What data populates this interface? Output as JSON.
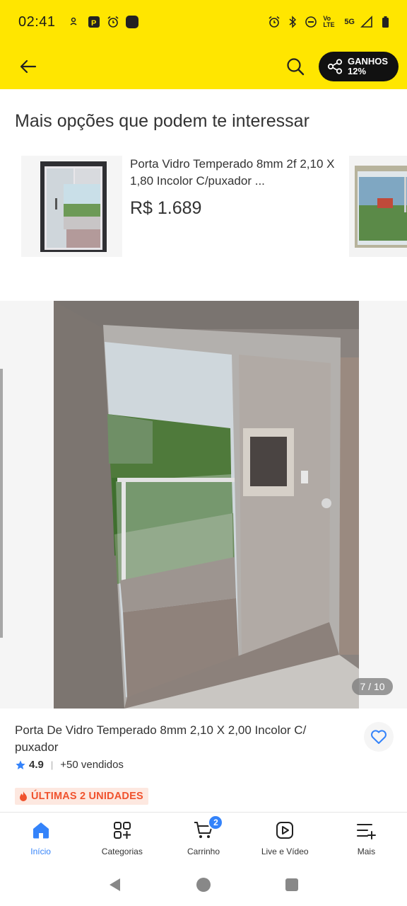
{
  "status_bar": {
    "time": "02:41",
    "network_label": "Vo LTE",
    "network_type": "5G",
    "icons": [
      "user-settings-icon",
      "parking-icon",
      "alarm-icon",
      "app-icon",
      "alarm-icon",
      "bluetooth-icon",
      "do-not-disturb-icon",
      "volte-icon",
      "signal-icon",
      "battery-icon"
    ]
  },
  "header": {
    "back_icon": "arrow-left-icon",
    "search_icon": "search-icon",
    "earn_button": {
      "line1": "GANHOS",
      "line2": "12%",
      "icon": "share-icon"
    }
  },
  "recommendations": {
    "title": "Mais opções que podem te interessar",
    "items": [
      {
        "title": "Porta Vidro Temperado 8mm 2f 2,10 X 1,80 Incolor C/puxador ...",
        "price": "R$ 1.689"
      }
    ]
  },
  "gallery": {
    "counter": "7 / 10"
  },
  "product": {
    "title": "Porta De Vidro Temperado 8mm 2,10 X 2,00 Incolor C/ puxador",
    "rating": "4.9",
    "sold": "+50 vendidos",
    "badge": "ÚLTIMAS 2 UNIDADES"
  },
  "bottom_nav": {
    "items": [
      {
        "label": "Início",
        "icon": "home-icon",
        "active": true
      },
      {
        "label": "Categorias",
        "icon": "categories-icon"
      },
      {
        "label": "Carrinho",
        "icon": "cart-icon",
        "badge": "2"
      },
      {
        "label": "Live e Vídeo",
        "icon": "play-icon"
      },
      {
        "label": "Mais",
        "icon": "menu-icon"
      }
    ]
  },
  "colors": {
    "brand_yellow": "#ffe600",
    "accent_blue": "#3483fa",
    "badge_orange": "#f0522d"
  }
}
